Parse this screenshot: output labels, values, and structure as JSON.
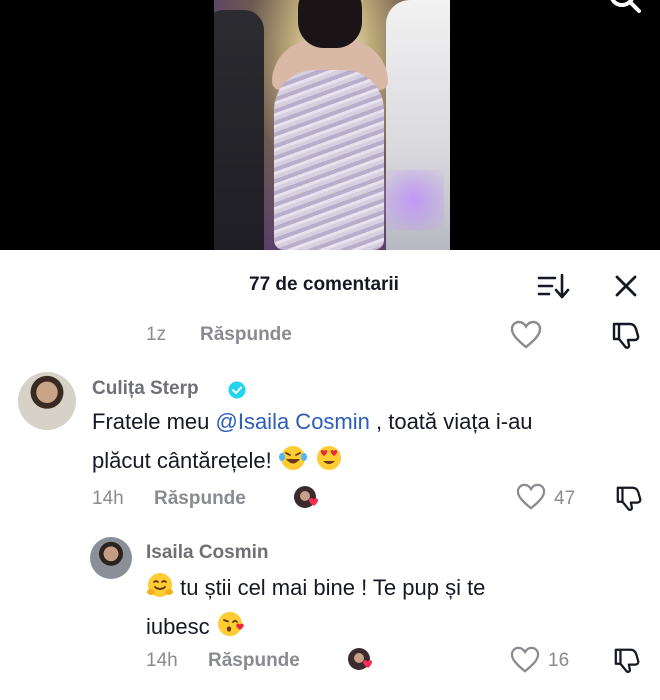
{
  "comments_panel": {
    "title": "77 de comentarii",
    "sort_icon": "sort-icon",
    "close_icon": "close-icon"
  },
  "top_row": {
    "time": "1z",
    "reply_label": "Răspunde"
  },
  "comments": [
    {
      "username": "Culița Sterp",
      "verified": true,
      "text_before_mention": "Fratele meu ",
      "mention": "@Isaila Cosmin",
      "text_after_mention": " , toată viața i-au",
      "text_line2": "plăcut cântărețele!",
      "emojis": [
        "laughing-tears-emoji",
        "heart-eyes-emoji"
      ],
      "time": "14h",
      "reply_label": "Răspunde",
      "likes": "47"
    },
    {
      "username": "Isaila Cosmin",
      "text_line1": " tu știi cel mai bine ! Te pup și te",
      "text_line2": "iubesc",
      "emojis": [
        "hugging-face-emoji",
        "kissing-heart-emoji"
      ],
      "time": "14h",
      "reply_label": "Răspunde",
      "likes": "16"
    }
  ],
  "colors": {
    "mention": "#2b5db9",
    "verified": "#20d5ec",
    "muted": "#8a8b91",
    "text": "#161823"
  }
}
